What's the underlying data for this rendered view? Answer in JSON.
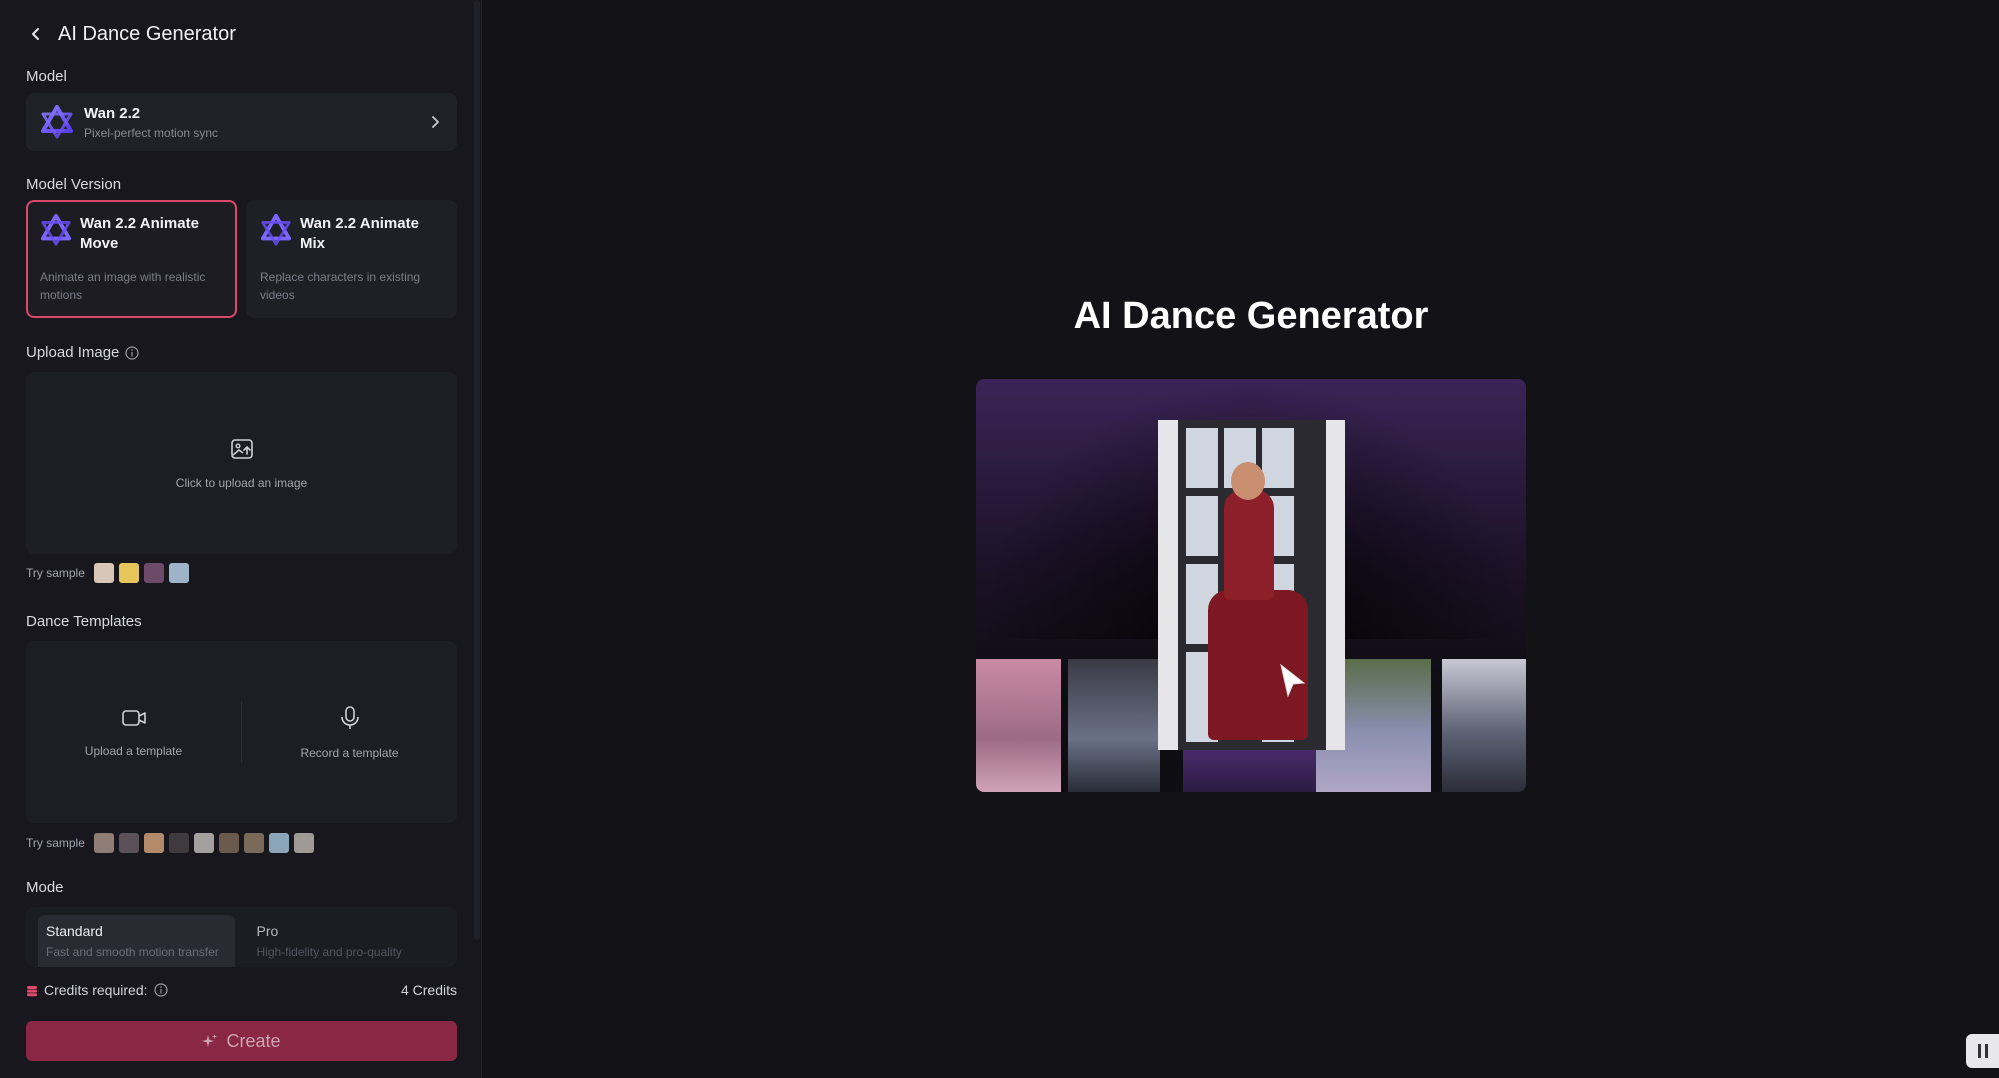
{
  "header": {
    "title": "AI Dance Generator"
  },
  "model": {
    "label": "Model",
    "name": "Wan 2.2",
    "subtitle": "Pixel-perfect motion sync"
  },
  "model_version": {
    "label": "Model Version",
    "options": [
      {
        "title": "Wan 2.2 Animate Move",
        "description": "Animate an image with realistic motions",
        "selected": true
      },
      {
        "title": "Wan 2.2 Animate Mix",
        "description": "Replace characters in existing videos",
        "selected": false
      }
    ]
  },
  "upload_image": {
    "label": "Upload Image",
    "prompt": "Click to upload an image",
    "try_sample_label": "Try sample",
    "sample_colors": [
      "#d8c6b6",
      "#e6c65a",
      "#6e4a6a",
      "#9fb3c8"
    ]
  },
  "dance_templates": {
    "label": "Dance Templates",
    "upload_label": "Upload a template",
    "record_label": "Record a template",
    "try_sample_label": "Try sample",
    "sample_colors": [
      "#8e7e76",
      "#5a5058",
      "#b38a6a",
      "#3e3a3e",
      "#a5a0a0",
      "#6a5a4e",
      "#7a6a5a",
      "#8aa4b8",
      "#a09a96"
    ]
  },
  "mode": {
    "label": "Mode",
    "options": [
      {
        "title": "Standard",
        "description": "Fast and smooth motion transfer",
        "active": true
      },
      {
        "title": "Pro",
        "description": "High-fidelity and pro-quality",
        "active": false
      }
    ]
  },
  "credits": {
    "label": "Credits required:",
    "value": "4 Credits"
  },
  "create_button": {
    "label": "Create"
  },
  "main": {
    "title": "AI Dance Generator"
  },
  "colors": {
    "accent": "#d94a6a",
    "create_bg": "#8a2745",
    "background": "#121217",
    "sidebar": "#17171d"
  }
}
